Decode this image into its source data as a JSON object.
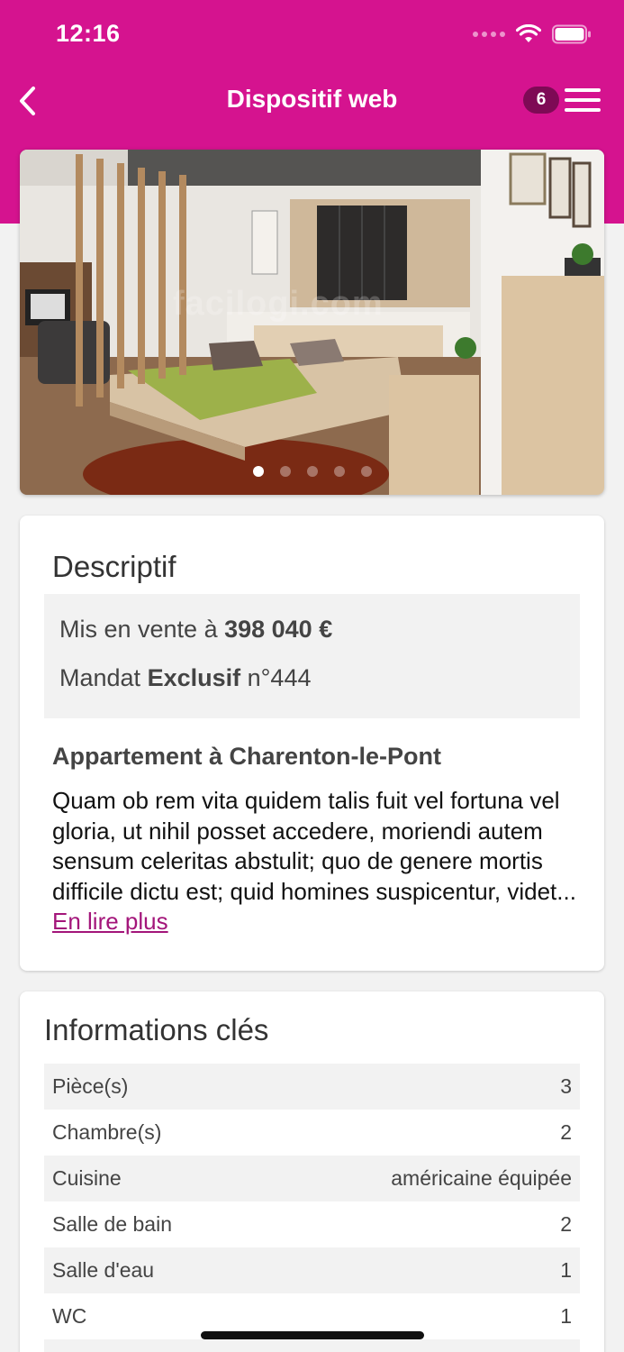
{
  "status": {
    "time": "12:16"
  },
  "nav": {
    "title": "Dispositif web",
    "badge_count": "6"
  },
  "photo": {
    "watermark": "facilogi.com",
    "slide_count": 5,
    "active_slide": 1
  },
  "description": {
    "heading": "Descriptif",
    "price_prefix": "Mis en vente à ",
    "price": "398 040 €",
    "mandate_prefix": "Mandat ",
    "mandate_type": "Exclusif",
    "mandate_number": " n°444",
    "property_title": "Appartement à Charenton-le-Pont",
    "text": "Quam ob rem vita quidem talis fuit vel fortuna vel gloria, ut nihil posset accedere, moriendi autem sensum celeritas abstulit; quo de genere mortis difficile dictu est; quid homines suspicentur, videt...",
    "read_more": " En lire plus"
  },
  "key_info": {
    "heading": "Informations clés",
    "rows": [
      {
        "label": "Pièce(s)",
        "value": "3"
      },
      {
        "label": "Chambre(s)",
        "value": "2"
      },
      {
        "label": "Cuisine",
        "value": "américaine équipée"
      },
      {
        "label": "Salle de bain",
        "value": "2"
      },
      {
        "label": "Salle d'eau",
        "value": "1"
      },
      {
        "label": "WC",
        "value": "1"
      }
    ]
  },
  "colors": {
    "brand": "#d5138f",
    "badge": "#7e0a55",
    "link": "#a3157a"
  }
}
